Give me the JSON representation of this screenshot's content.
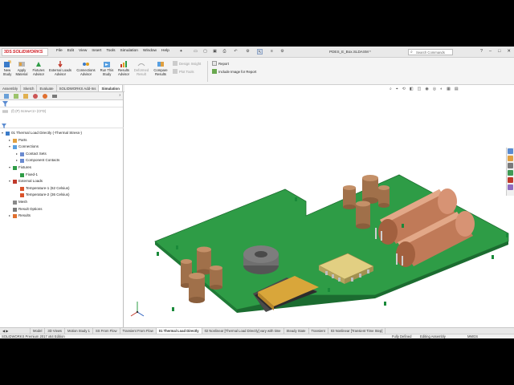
{
  "app": {
    "brand_prefix": "3DS",
    "brand_name": "SOLIDWORKS",
    "doc_title": "PDES_E_Box.SLDASM *"
  },
  "menu": [
    "File",
    "Edit",
    "View",
    "Insert",
    "Tools",
    "Simulation",
    "Window",
    "Help"
  ],
  "search": {
    "placeholder": "Search Commands"
  },
  "commands": {
    "new_study": "New\nStudy",
    "apply_material": "Apply\nMaterial",
    "fixtures_advisor": "Fixtures\nAdvisor",
    "external_loads_advisor": "External Loads\nAdvisor",
    "connections_advisor": "Connections\nAdvisor",
    "run_study": "Run This\nStudy",
    "results_advisor": "Results\nAdvisor",
    "deformed_result": "Deformed\nResult",
    "compare_results": "Compare\nResults",
    "design_insight": "Design Insight",
    "plot_tools": "Plot Tools",
    "report": "Report",
    "include_image": "Include Image for Report"
  },
  "command_tabs": [
    "Assembly",
    "Sketch",
    "Evaluate",
    "SOLIDWORKS Add-Ins",
    "Simulation"
  ],
  "active_command_tab": "Simulation",
  "config_label": "(f) (P) Screw<1> (CFD)",
  "tree": [
    {
      "label": "01 Thermal Load Directly (-Thermal Stress-)",
      "indent": 0,
      "exp": "-",
      "icon": "study"
    },
    {
      "label": "Parts",
      "indent": 1,
      "exp": "+",
      "icon": "parts"
    },
    {
      "label": "Connections",
      "indent": 1,
      "exp": "-",
      "icon": "conn"
    },
    {
      "label": "Contact Sets",
      "indent": 2,
      "exp": "+",
      "icon": "contact"
    },
    {
      "label": "Component Contacts",
      "indent": 2,
      "exp": "+",
      "icon": "contact"
    },
    {
      "label": "Fixtures",
      "indent": 1,
      "exp": "-",
      "icon": "fixture"
    },
    {
      "label": "Fixed-1",
      "indent": 2,
      "exp": "",
      "icon": "fixed"
    },
    {
      "label": "External Loads",
      "indent": 1,
      "exp": "-",
      "icon": "load"
    },
    {
      "label": "Temperature-1 (62 Celsius)",
      "indent": 2,
      "exp": "",
      "icon": "temp"
    },
    {
      "label": "Temperature-2 (36 Celsius)",
      "indent": 2,
      "exp": "",
      "icon": "temp"
    },
    {
      "label": "Mesh",
      "indent": 1,
      "exp": "",
      "icon": "mesh"
    },
    {
      "label": "Result Options",
      "indent": 1,
      "exp": "",
      "icon": "resopt"
    },
    {
      "label": "Results",
      "indent": 1,
      "exp": "+",
      "icon": "results"
    }
  ],
  "bottom_tabs": [
    "Model",
    "3D Views",
    "Motion Study 1",
    "SS From Flow",
    "Transient From Flow",
    "01 Thermal Load Directly",
    "02 Nonlinear [Thermal Load Directly] vary with time",
    "Steady State",
    "Transient",
    "03 Nonlinear [Transient Time Step]"
  ],
  "active_bottom_tab": "01 Thermal Load Directly",
  "status": {
    "edition": "SOLIDWORKS Premium 2017 x64 Edition",
    "defined": "Fully Defined",
    "editing": "Editing Assembly",
    "units": "MMGS"
  },
  "colors": {
    "pcb": "#2e9c46",
    "heatsink": "#d9a63a",
    "capacitor": "#b07d52",
    "cylinder": "#c07a58",
    "toroid": "#6f6f6f",
    "ic": "#e2cf82",
    "brand": "#d2232a"
  }
}
